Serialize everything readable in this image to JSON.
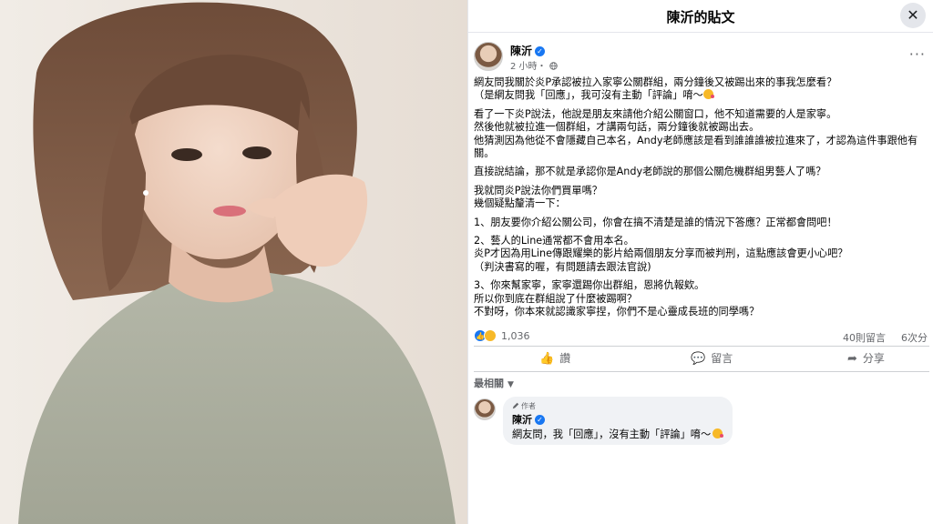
{
  "dialog": {
    "title": "陳沂的貼文",
    "close_symbol": "✕"
  },
  "post": {
    "author": "陳沂",
    "verified_symbol": "✓",
    "time": "2 小時・",
    "privacy_icon": "globe-icon",
    "more_symbol": "···",
    "paragraphs": [
      [
        "網友問我關於炎P承認被拉入家寧公關群組，兩分鐘後又被踢出來的事我怎麼看？",
        "（是網友問我「回應」，我可沒有主動「評論」唷～"
      ],
      [
        "看了一下炎P說法，他說是朋友來請他介紹公關窗口，他不知道需要的人是家寧。",
        "然後他就被拉進一個群組，才講兩句話，兩分鐘後就被踢出去。",
        "他猜測因為他從不會隱藏自己本名，Andy老師應該是看到誰誰誰被拉進來了，才認為這件事跟他有",
        "關。"
      ],
      [
        "直接說結論，那不就是承認你是Andy老師說的那個公關危機群組男藝人了嗎？"
      ],
      [
        "我就問炎P說法你們買單嗎？",
        "幾個疑點釐清一下："
      ],
      [
        "1、朋友要你介紹公關公司，你會在搞不清楚是誰的情況下答應？正常都會問吧！"
      ],
      [
        "2、藝人的Line通常都不會用本名。",
        "炎P才因為用Line傳跟耀樂的影片給兩個朋友分享而被判刑，這點應該會更小心吧？",
        "（判決書寫的喔，有問題請去跟法官說)"
      ],
      [
        "3、你來幫家寧，家寧還踢你出群組，恩將仇報欸。",
        "所以你到底在群組說了什麼被踢啊？",
        "不對呀，你本來就認識家寧捏，你們不是心靈成長班的同學嗎？"
      ]
    ]
  },
  "stats": {
    "reaction_count": "1,036",
    "like_symbol": "👍",
    "comments": "40則留言",
    "shares": "6次分"
  },
  "actions": [
    {
      "label": "讚",
      "icon": "like-icon",
      "symbol": "👍"
    },
    {
      "label": "留言",
      "icon": "comment-icon",
      "symbol": "💬"
    },
    {
      "label": "分享",
      "icon": "share-icon",
      "symbol": "➦"
    }
  ],
  "sort": {
    "label": "最相關",
    "caret": "▼"
  },
  "comment": {
    "badge": "作者",
    "badge_icon": "pencil-icon",
    "author": "陳沂",
    "text": "網友問，我「回應」，沒有主動「評論」唷～"
  }
}
